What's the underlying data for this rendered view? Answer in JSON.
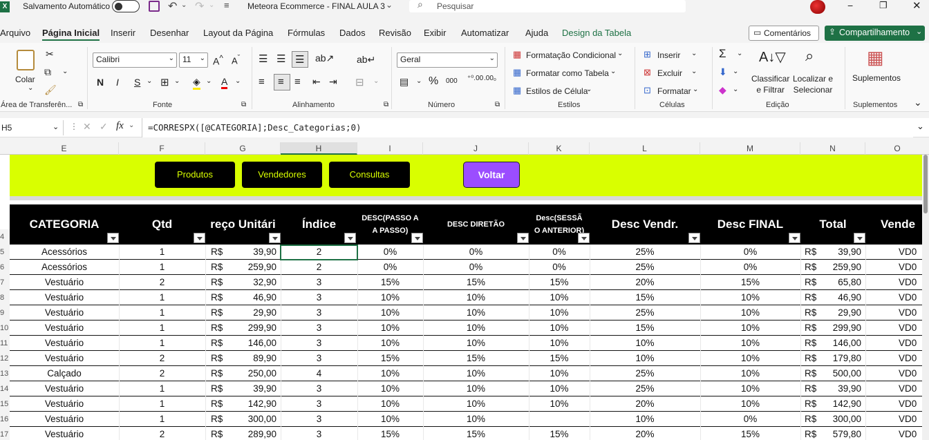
{
  "titlebar": {
    "autosave_label": "Salvamento Automático",
    "toggle_state": "Desativado",
    "file_title": "Meteora Ecommerce - FINAL AULA 3",
    "search_placeholder": "Pesquisar"
  },
  "menu": [
    "Arquivo",
    "Página Inicial",
    "Inserir",
    "Desenhar",
    "Layout da Página",
    "Fórmulas",
    "Dados",
    "Revisão",
    "Exibir",
    "Automatizar",
    "Ajuda",
    "Design da Tabela"
  ],
  "menu_active": "Página Inicial",
  "comments_label": "Comentários",
  "share_label": "Compartilhamento",
  "ribbon": {
    "paste_label": "Colar",
    "clipboard_group": "Área de Transferên...",
    "font_name": "Calibri",
    "font_size": "11",
    "bold": "N",
    "italic": "I",
    "underline": "S",
    "font_group": "Fonte",
    "align_group": "Alinhamento",
    "number_format": "Geral",
    "number_group": "Número",
    "cond_format": "Formatação Condicional",
    "format_table": "Formatar como Tabela",
    "cell_styles": "Estilos de Célula",
    "styles_group": "Estilos",
    "insert": "Inserir",
    "delete": "Excluir",
    "format": "Formatar",
    "cells_group": "Células",
    "sort_filter": "Classificar\ne Filtrar",
    "find_select": "Localizar e\nSelecionar",
    "edit_group": "Edição",
    "addins": "Suplementos",
    "addins_group": "Suplementos"
  },
  "formula_bar": {
    "name_box": "H5",
    "formula": "=CORRESPX([@CATEGORIA];Desc_Categorias;0)"
  },
  "columns": [
    "E",
    "F",
    "G",
    "H",
    "I",
    "J",
    "K",
    "L",
    "M",
    "N",
    "O"
  ],
  "buttons": {
    "produtos": "Produtos",
    "vendedores": "Vendedores",
    "consultas": "Consultas",
    "voltar": "Voltar"
  },
  "headers": [
    "CATEGORIA",
    "Qtd",
    "reço Unitári",
    "Índice",
    "DESC(PASSO A A PASSO)",
    "DESC  DIRETÃO",
    "Desc(SESSÃ O ANTERIOR)",
    "Desc Vendr.",
    "Desc FINAL",
    "Total",
    "Vende"
  ],
  "row_numbers": [
    "4",
    "5",
    "6",
    "7",
    "8",
    "9",
    "10",
    "11",
    "12",
    "13",
    "14",
    "15",
    "16",
    "17"
  ],
  "rows": [
    [
      "Acessórios",
      "1",
      "R$",
      "39,90",
      "2",
      "0%",
      "0%",
      "0%",
      "25%",
      "0%",
      "R$",
      "39,90",
      "VD0"
    ],
    [
      "Acessórios",
      "1",
      "R$",
      "259,90",
      "2",
      "0%",
      "0%",
      "0%",
      "25%",
      "0%",
      "R$",
      "259,90",
      "VD0"
    ],
    [
      "Vestuário",
      "2",
      "R$",
      "32,90",
      "3",
      "15%",
      "15%",
      "15%",
      "20%",
      "15%",
      "R$",
      "65,80",
      "VD0"
    ],
    [
      "Vestuário",
      "1",
      "R$",
      "46,90",
      "3",
      "10%",
      "10%",
      "10%",
      "15%",
      "10%",
      "R$",
      "46,90",
      "VD0"
    ],
    [
      "Vestuário",
      "1",
      "R$",
      "29,90",
      "3",
      "10%",
      "10%",
      "10%",
      "25%",
      "10%",
      "R$",
      "29,90",
      "VD0"
    ],
    [
      "Vestuário",
      "1",
      "R$",
      "299,90",
      "3",
      "10%",
      "10%",
      "10%",
      "15%",
      "10%",
      "R$",
      "299,90",
      "VD0"
    ],
    [
      "Vestuário",
      "1",
      "R$",
      "146,00",
      "3",
      "10%",
      "10%",
      "10%",
      "10%",
      "10%",
      "R$",
      "146,00",
      "VD0"
    ],
    [
      "Vestuário",
      "2",
      "R$",
      "89,90",
      "3",
      "15%",
      "15%",
      "15%",
      "10%",
      "10%",
      "R$",
      "179,80",
      "VD0"
    ],
    [
      "Calçado",
      "2",
      "R$",
      "250,00",
      "4",
      "10%",
      "10%",
      "10%",
      "25%",
      "10%",
      "R$",
      "500,00",
      "VD0"
    ],
    [
      "Vestuário",
      "1",
      "R$",
      "39,90",
      "3",
      "10%",
      "10%",
      "10%",
      "25%",
      "10%",
      "R$",
      "39,90",
      "VD0"
    ],
    [
      "Vestuário",
      "1",
      "R$",
      "142,90",
      "3",
      "10%",
      "10%",
      "10%",
      "20%",
      "10%",
      "R$",
      "142,90",
      "VD0"
    ],
    [
      "Vestuário",
      "1",
      "R$",
      "300,00",
      "3",
      "10%",
      "10%",
      "",
      "10%",
      "0%",
      "R$",
      "300,00",
      "VD0"
    ],
    [
      "Vestuário",
      "2",
      "R$",
      "289,90",
      "3",
      "15%",
      "15%",
      "15%",
      "20%",
      "15%",
      "R$",
      "579,80",
      "VD0"
    ]
  ],
  "colors": {
    "accent": "#d9ff00",
    "voltar": "#9b4dff",
    "share": "#1e7145"
  }
}
